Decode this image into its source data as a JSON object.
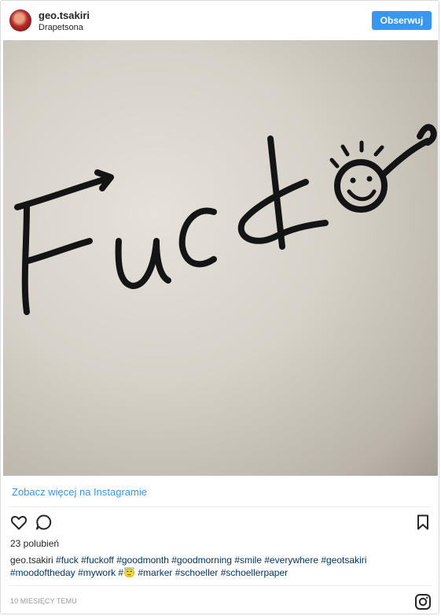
{
  "header": {
    "username": "geo.tsakiri",
    "location": "Drapetsona",
    "follow_label": "Obserwuj"
  },
  "photo": {
    "handwritten_text": "Fuck"
  },
  "see_more_label": "Zobacz więcej na Instagramie",
  "actions": {
    "like_icon": "heart-outline-icon",
    "comment_icon": "speech-bubble-icon",
    "save_icon": "bookmark-icon"
  },
  "likes_label": "23 polubień",
  "caption": {
    "username": "geo.tsakiri",
    "tags_line1": "#fuck #fuckoff #goodmonth #goodmorning #smile #everywhere #geotsakiri",
    "tags_line2a": "#moodoftheday #mywork #",
    "emoji": "😇",
    "tags_line2b": " #marker #schoeller #schoellerpaper"
  },
  "timestamp": "10 MIESIĘCY TEMU",
  "footer_icon": "instagram-logo-icon",
  "colors": {
    "accent": "#3897f0",
    "hashtag": "#003569",
    "text": "#262626",
    "muted": "#999999"
  }
}
